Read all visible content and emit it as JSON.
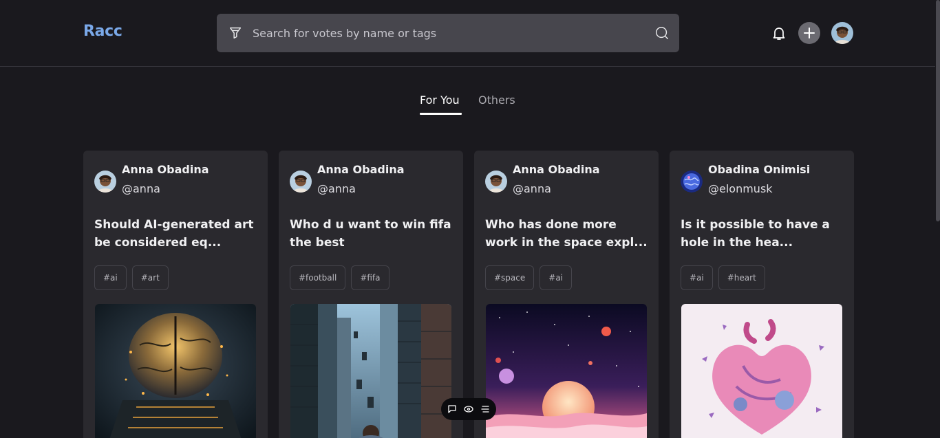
{
  "header": {
    "logo": "Racc",
    "search_placeholder": "Search for votes by name or tags"
  },
  "icons": {
    "filter": "filter-icon",
    "search": "search-icon",
    "bell": "bell-icon",
    "plus": "plus-icon"
  },
  "tabs": [
    {
      "label": "For You",
      "active": true
    },
    {
      "label": "Others",
      "active": false
    }
  ],
  "cards": [
    {
      "name": "Anna Obadina",
      "handle": "@anna",
      "question": "Should AI-generated art be considered eq...",
      "tags": [
        "#ai",
        "#art"
      ]
    },
    {
      "name": "Anna Obadina",
      "handle": "@anna",
      "question": "Who d u want to win fifa the best",
      "tags": [
        "#football",
        "#fifa"
      ]
    },
    {
      "name": "Anna Obadina",
      "handle": "@anna",
      "question": "Who has done more work in the space expl...",
      "tags": [
        "#space",
        "#ai"
      ]
    },
    {
      "name": "Obadina Onimisi",
      "handle": "@elonmusk",
      "question": "Is it possible to have a hole in the hea...",
      "tags": [
        "#ai",
        "#heart"
      ]
    }
  ],
  "colors": {
    "background": "#1a191e",
    "card": "#2a292e",
    "logo": "#7aa8e8",
    "search_bg": "#47464d"
  }
}
